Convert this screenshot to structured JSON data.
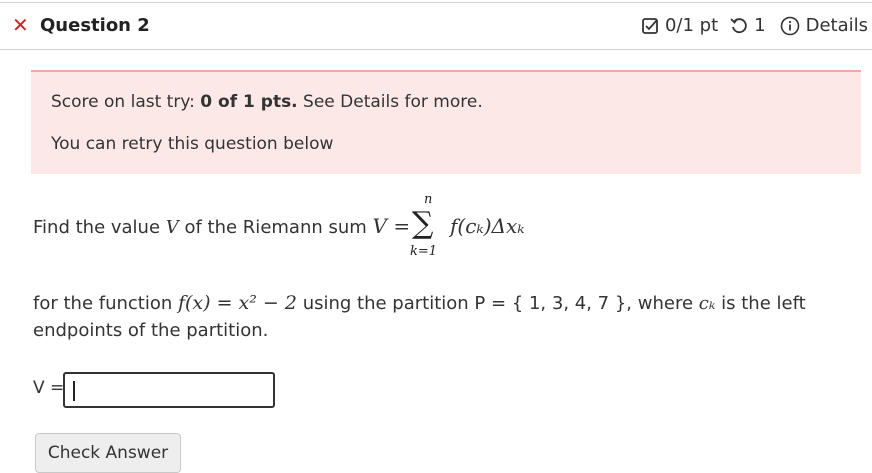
{
  "header": {
    "question_title": "Question 2",
    "points": "0/1 pt",
    "tries": "1",
    "details_label": "Details"
  },
  "alert": {
    "score_prefix": "Score on last try: ",
    "score_value": "0 of 1 pts.",
    "score_suffix": " See Details for more.",
    "retry_text": "You can retry this question below"
  },
  "problem": {
    "intro": "Find the value ",
    "v_var": "V",
    "of_riemann": " of the Riemann sum ",
    "sum_lhs": "V =",
    "sum_upper": "n",
    "sum_lower": "k=1",
    "sum_body": "f(cₖ)Δxₖ",
    "function_prefix": "for the function ",
    "function_expr": "f(x) = x² − 2",
    "partition_text": " using the partition P = { 1, 3, 4, 7 }, where ",
    "ck": "cₖ",
    "is_left": " is the left",
    "endpoints": "endpoints of the partition."
  },
  "answer": {
    "label": "V =",
    "value": ""
  },
  "buttons": {
    "check_answer": "Check Answer"
  },
  "colors": {
    "error_red": "#c62828",
    "alert_bg": "#fde8e8",
    "alert_border": "#f3a6a6"
  }
}
